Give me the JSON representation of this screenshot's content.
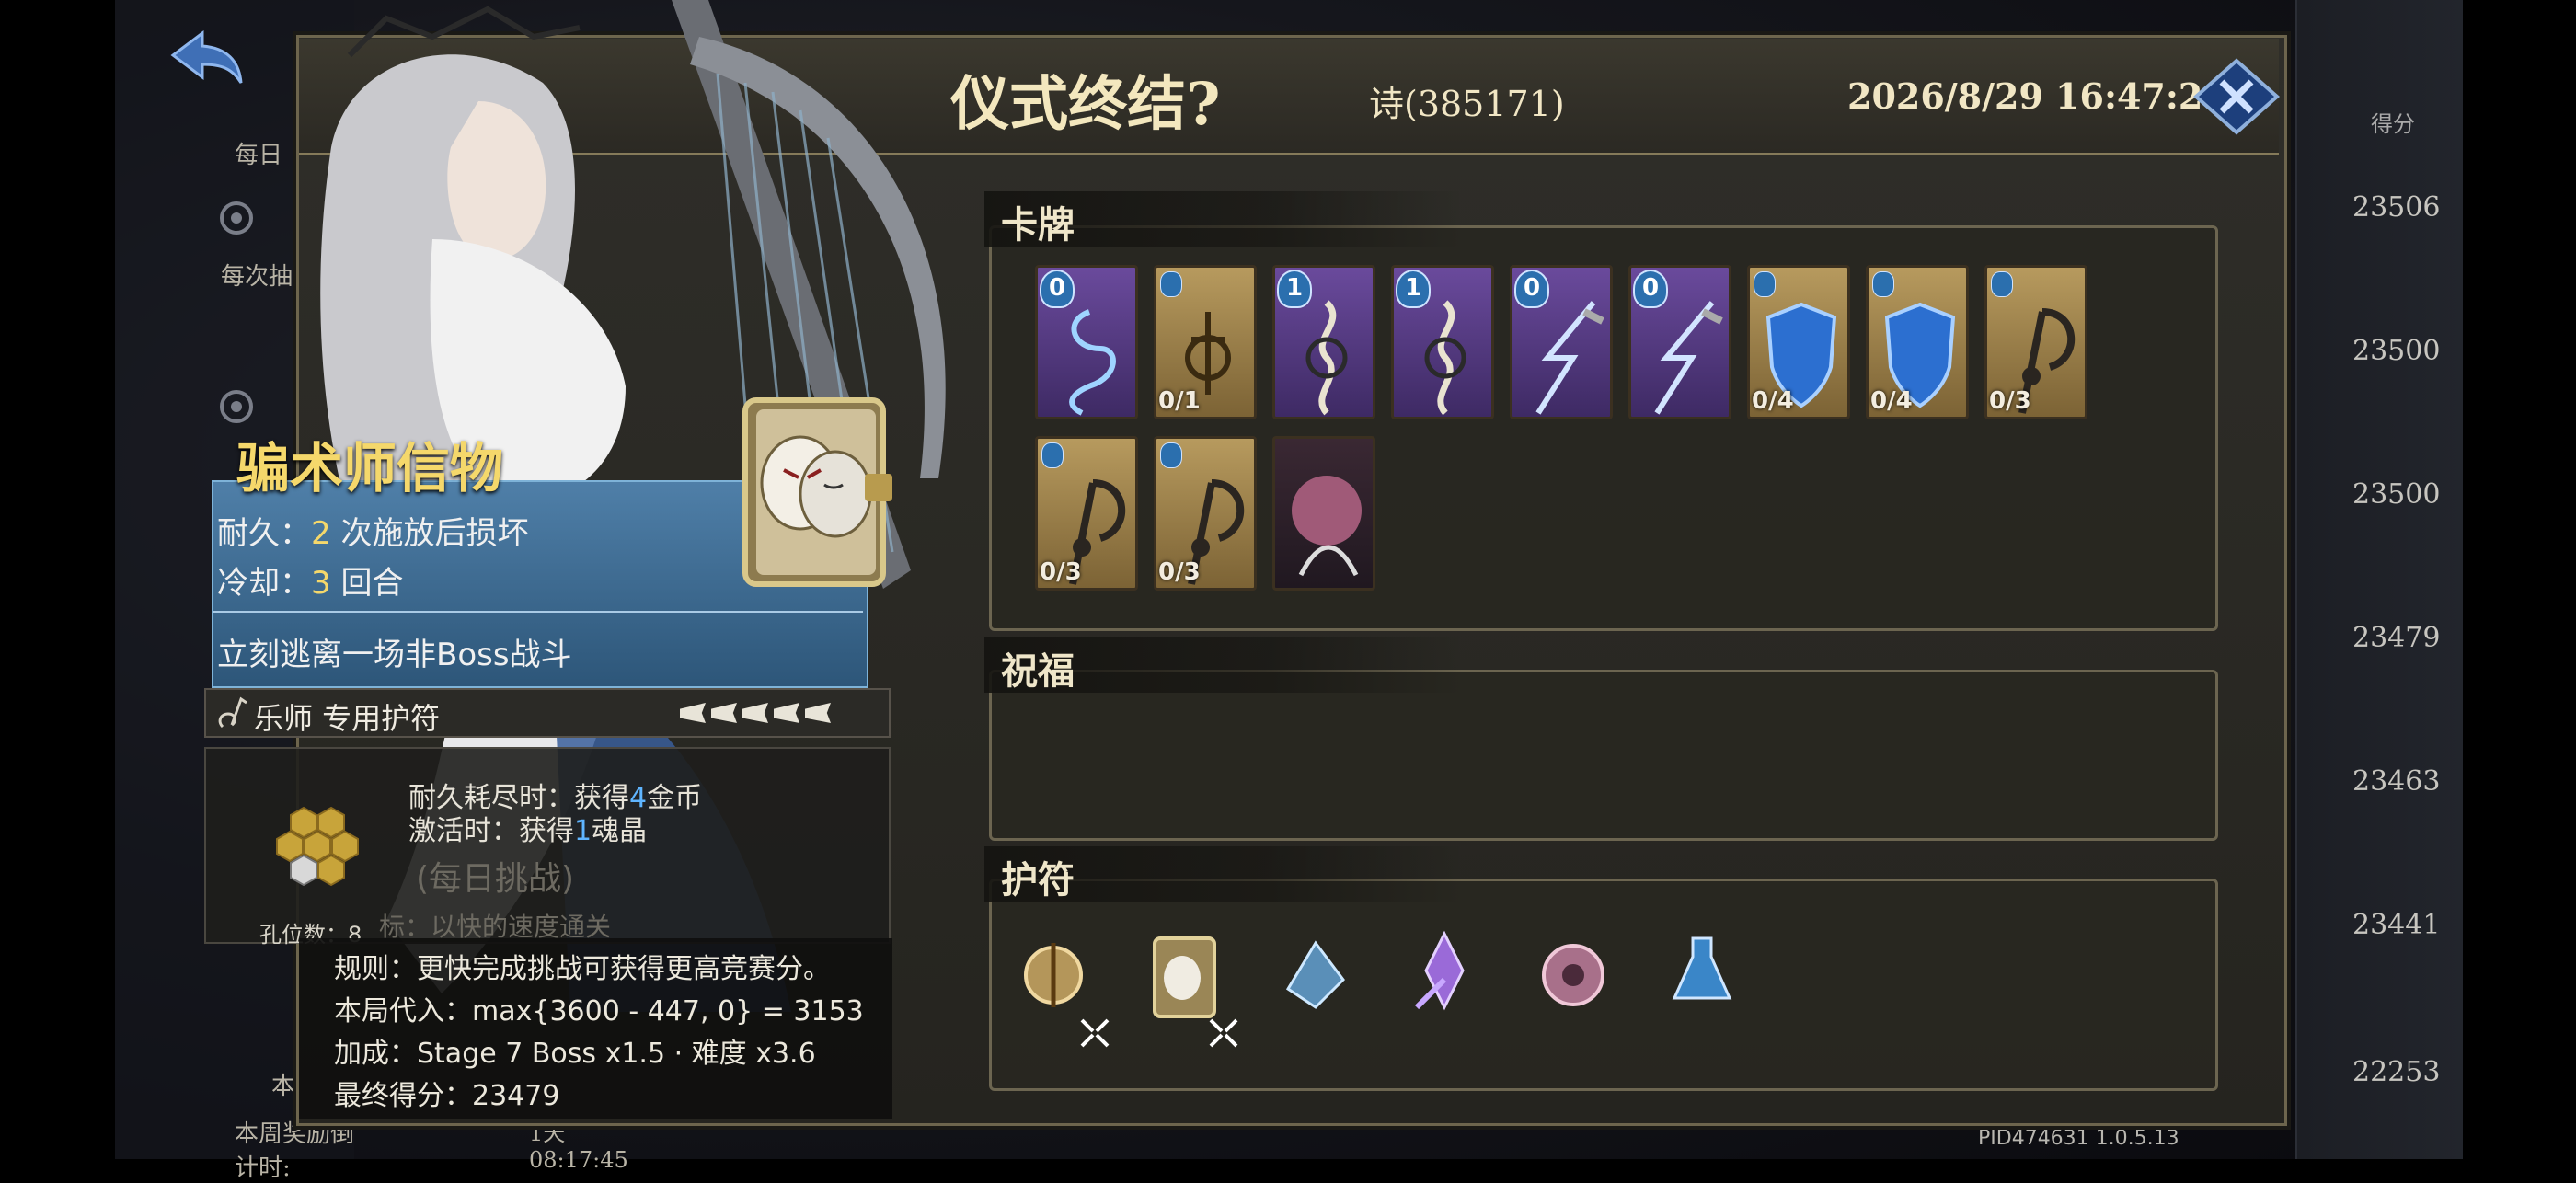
{
  "background": {
    "left_labels": [
      "每日",
      "每次抽",
      "本",
      "本周奖励倒计时:"
    ],
    "left_countdown": "1天 08:17:45",
    "score_header": "得分",
    "scores": [
      "23506",
      "23500",
      "23500",
      "23479",
      "23463",
      "23441",
      "22253"
    ],
    "pid": "PID474631  1.0.5.13"
  },
  "dialog": {
    "title": "仪式终结?",
    "player": "诗(385171)",
    "datetime": "2026/8/29 16:47:28",
    "close_icon": "close-x-icon"
  },
  "sections": {
    "cards_title": "卡牌",
    "blessing_title": "祝福",
    "amulet_title": "护符"
  },
  "cards": [
    {
      "frame": "purple",
      "cost": "0",
      "uses": "",
      "icon": "spiral-spirit-icon"
    },
    {
      "frame": "gold",
      "cost": "",
      "uses": "0/1",
      "icon": "music-note-rune-icon"
    },
    {
      "frame": "purple",
      "cost": "1",
      "uses": "",
      "icon": "treble-clef-swirl-icon"
    },
    {
      "frame": "purple",
      "cost": "1",
      "uses": "",
      "icon": "treble-clef-swirl-icon"
    },
    {
      "frame": "purple",
      "cost": "0",
      "uses": "",
      "icon": "chain-lightning-icon"
    },
    {
      "frame": "purple",
      "cost": "0",
      "uses": "",
      "icon": "chain-lightning-icon"
    },
    {
      "frame": "gold",
      "cost": "",
      "uses": "0/4",
      "icon": "blue-shield-icon"
    },
    {
      "frame": "gold",
      "cost": "",
      "uses": "0/4",
      "icon": "blue-shield-icon"
    },
    {
      "frame": "gold",
      "cost": "",
      "uses": "0/3",
      "icon": "scythe-note-icon"
    },
    {
      "frame": "gold",
      "cost": "",
      "uses": "0/3",
      "icon": "scythe-note-icon"
    },
    {
      "frame": "gold",
      "cost": "",
      "uses": "0/3",
      "icon": "scythe-note-icon"
    },
    {
      "frame": "dark",
      "cost": "",
      "uses": "",
      "icon": "brain-curse-icon"
    }
  ],
  "amulets": [
    {
      "icon": "rune-charm-icon",
      "badge": true
    },
    {
      "icon": "mask-book-icon",
      "badge": true
    },
    {
      "icon": "crystal-bird-icon",
      "badge": false
    },
    {
      "icon": "violet-key-icon",
      "badge": false
    },
    {
      "icon": "pink-shell-icon",
      "badge": false
    },
    {
      "icon": "blue-potion-icon",
      "badge": false
    }
  ],
  "tooltip": {
    "name": "骗术师信物",
    "durability_label": "耐久：",
    "durability_value": "2",
    "durability_suffix": "次施放后损坏",
    "cooldown_label": "冷却：",
    "cooldown_value": "3",
    "cooldown_suffix": "回合",
    "effect": "立刻逃离一场非Boss战斗",
    "class_text": "乐师 专用护符",
    "stars_filled": 5,
    "stars_total": 5
  },
  "socket": {
    "line1_prefix": "耐久耗尽时：获得",
    "line1_value": "4",
    "line1_suffix": "金币",
    "line2_prefix": "激活时：获得",
    "line2_value": "1",
    "line2_suffix": "魂晶",
    "slot_label": "孔位数：8",
    "faded_title": "(每日挑战)",
    "faded_goal": "标：以快的速度通关"
  },
  "rules": {
    "line1": "规则：更快完成挑战可获得更高竞赛分。",
    "line2": "本局代入：max{3600 - 447, 0} = 3153",
    "line3": "加成：Stage 7 Boss x1.5 · 难度 x3.6",
    "line4": "最终得分：23479"
  }
}
